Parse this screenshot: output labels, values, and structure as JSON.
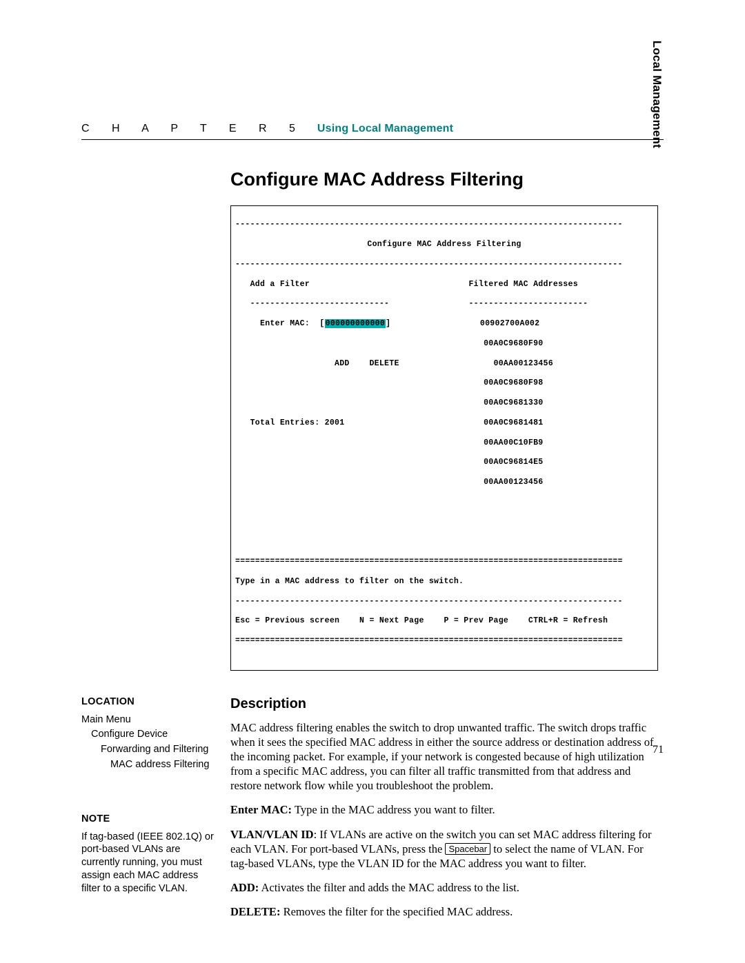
{
  "header": {
    "chapter_label": "C H A P T E R 5",
    "chapter_title": "Using Local Management"
  },
  "side_tab": "Local Management",
  "title": "Configure MAC Address Filtering",
  "terminal": {
    "rule_equals": "==============================================================================",
    "rule_dashes": "------------------------------------------------------------------------------",
    "screen_title": "Configure MAC Address Filtering",
    "add_filter_label": "Add a Filter",
    "add_filter_rule": "----------------------------",
    "filtered_label": "Filtered MAC Addresses",
    "filtered_rule": "------------------------",
    "enter_mac_label": "Enter MAC:",
    "enter_mac_value": "000000000000",
    "add_btn": "ADD",
    "delete_btn": "DELETE",
    "total_entries_label": "Total Entries:",
    "total_entries_value": "2001",
    "mac_list": [
      "00902700A002",
      "00A0C9680F90",
      "00AA00123456",
      "00A0C9680F98",
      "00A0C9681330",
      "00A0C9681481",
      "00AA00C10FB9",
      "00A0C96814E5",
      "00AA00123456"
    ],
    "hint": "Type in a MAC address to filter on the switch.",
    "nav": {
      "esc": "Esc = Previous screen",
      "next": "N = Next Page",
      "prev": "P = Prev Page",
      "refresh": "CTRL+R = Refresh"
    }
  },
  "sidebar": {
    "location_heading": "LOCATION",
    "loc0": "Main Menu",
    "loc1": "Configure Device",
    "loc2": "Forwarding and Filtering",
    "loc3": "MAC address Filtering",
    "note_heading": "NOTE",
    "note_body": "If tag-based (IEEE 802.1Q) or port-based VLANs are currently running, you must assign each MAC address filter to a specific VLAN."
  },
  "body": {
    "description_heading": "Description",
    "para1": "MAC address filtering enables the switch to drop unwanted traffic. The switch drops traffic when it sees the specified MAC address in either the source address or destination address of the incoming packet. For example, if your network is congested because of high utilization from a specific MAC address, you can filter all traffic transmitted from that address and restore network flow while you troubleshoot the problem.",
    "enter_mac_label": "Enter MAC:",
    "enter_mac_text": " Type in the MAC address you want to filter.",
    "vlan_label": "VLAN/VLAN ID",
    "vlan_text_a": ": If VLANs are active on the switch you can set MAC address filtering for each VLAN. For port-based VLANs, press the ",
    "spacebar_key": "Spacebar",
    "vlan_text_b": " to select the name of VLAN. For tag-based VLANs, type the VLAN ID for the MAC address you want to filter.",
    "add_label": "ADD:",
    "add_text": " Activates the filter and adds the MAC address to the list.",
    "delete_label": "DELETE:",
    "delete_text": " Removes the filter for the specified MAC address."
  },
  "page_number": "71"
}
